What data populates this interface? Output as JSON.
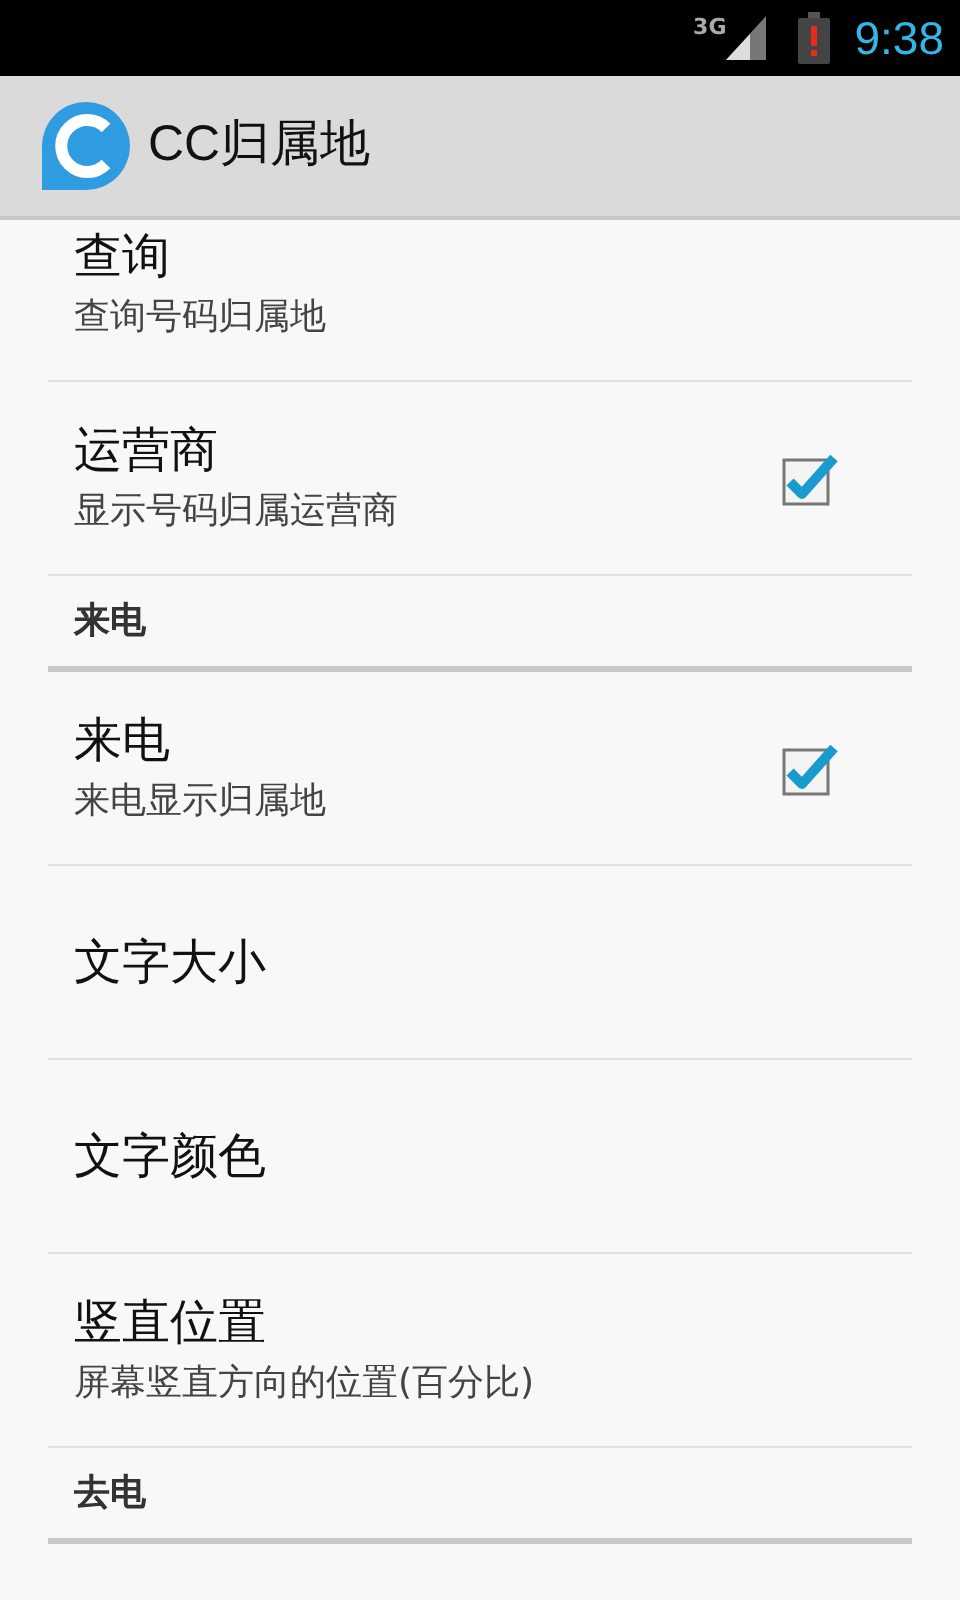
{
  "status_bar": {
    "network": "3G",
    "time": "9:38"
  },
  "app_bar": {
    "title": "CC归属地"
  },
  "items": [
    {
      "kind": "pref",
      "title": "查询",
      "summary": "查询号码归属地"
    },
    {
      "kind": "checkbox",
      "title": "运营商",
      "summary": "显示号码归属运营商",
      "checked": true
    },
    {
      "kind": "category",
      "title": "来电"
    },
    {
      "kind": "checkbox",
      "title": "来电",
      "summary": "来电显示归属地",
      "checked": true
    },
    {
      "kind": "pref",
      "title": "文字大小"
    },
    {
      "kind": "pref",
      "title": "文字颜色"
    },
    {
      "kind": "pref",
      "title": "竖直位置",
      "summary": "屏幕竖直方向的位置(百分比)"
    },
    {
      "kind": "category",
      "title": "去电"
    }
  ]
}
